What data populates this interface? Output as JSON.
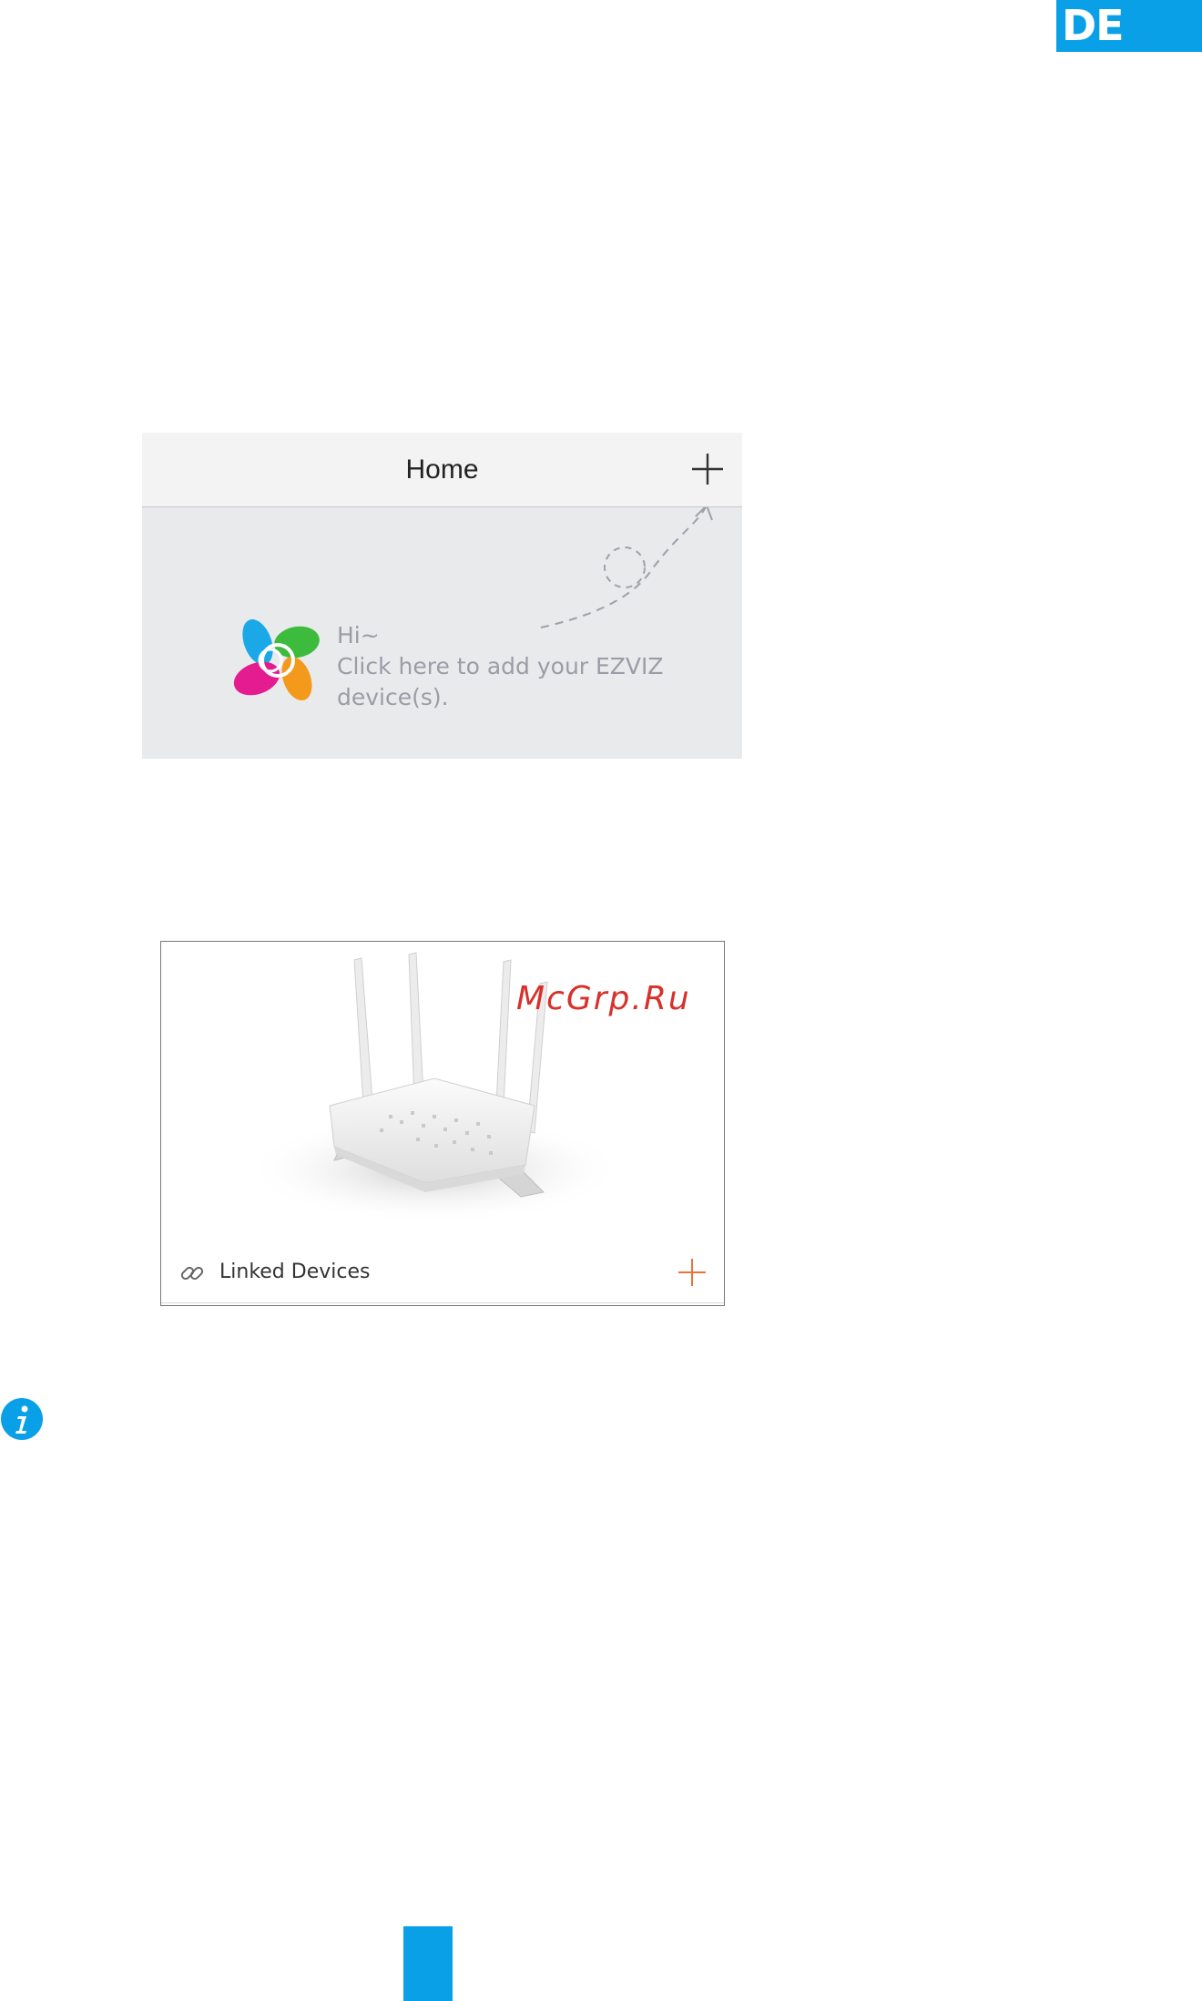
{
  "lang_badge": "DE",
  "home_screen": {
    "title": "Home",
    "message_line1": "Hi~",
    "message_line2": "Click here to add your EZVIZ",
    "message_line3": "device(s).",
    "add_icon": "plus-icon",
    "logo": "ezviz-logo"
  },
  "router_screen": {
    "watermark": "McGrp.Ru",
    "linked_label": "Linked Devices",
    "link_icon": "link-icon",
    "add_icon": "plus-icon",
    "accent_color": "#e8743c"
  },
  "colors": {
    "brand_blue": "#0aa0e8"
  }
}
